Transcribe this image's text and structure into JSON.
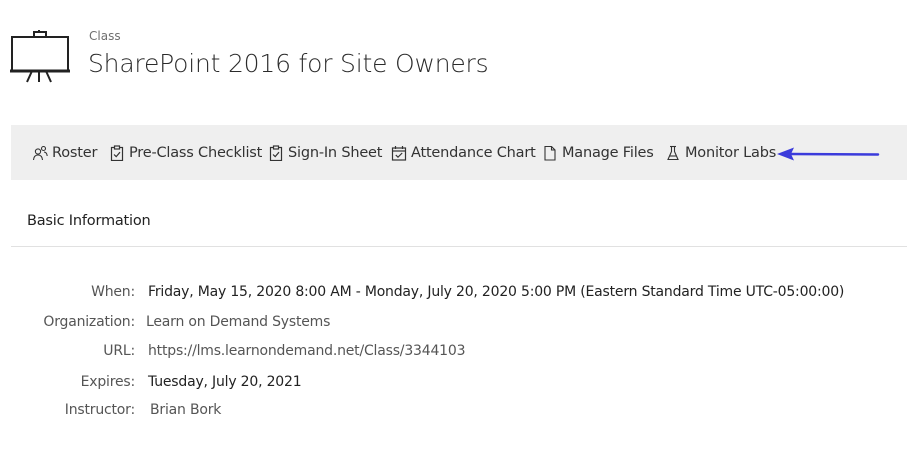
{
  "header": {
    "kicker": "Class",
    "title": "SharePoint 2016 for Site Owners",
    "icon": "presentation-board-icon"
  },
  "toolbar": {
    "items": [
      {
        "label": "Roster",
        "icon": "roster-icon"
      },
      {
        "label": "Pre-Class Checklist",
        "icon": "clipboard-check-icon"
      },
      {
        "label": "Sign-In Sheet",
        "icon": "clipboard-check-icon"
      },
      {
        "label": "Attendance Chart",
        "icon": "calendar-check-icon"
      },
      {
        "label": "Manage Files",
        "icon": "file-icon"
      },
      {
        "label": "Monitor Labs",
        "icon": "flask-icon"
      }
    ],
    "pointer_color": "#3b3bdb"
  },
  "section": {
    "title": "Basic Information"
  },
  "info": {
    "when": {
      "label": "When:",
      "value": "Friday, May 15, 2020 8:00 AM - Monday, July 20, 2020 5:00 PM (Eastern Standard Time UTC-05:00:00)"
    },
    "organization": {
      "label": "Organization:",
      "value": "Learn on Demand Systems"
    },
    "url": {
      "label": "URL:",
      "value": "https://lms.learnondemand.net/Class/3344103"
    },
    "expires": {
      "label": "Expires:",
      "value": "Tuesday, July 20, 2021"
    },
    "instructor": {
      "label": "Instructor:",
      "value": "Brian Bork"
    }
  }
}
